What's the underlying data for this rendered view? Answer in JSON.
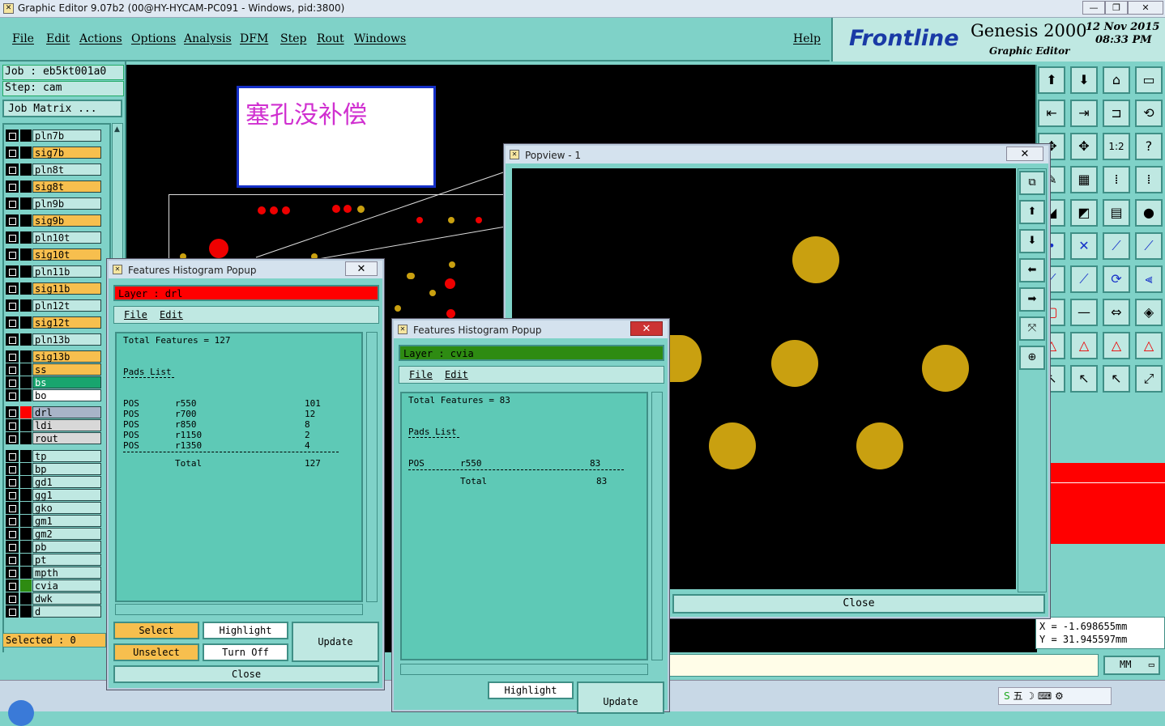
{
  "window": {
    "title": "Graphic Editor 9.07b2 (00@HY-HYCAM-PC091 - Windows, pid:3800)"
  },
  "menu": {
    "items": [
      "File",
      "Edit",
      "Actions",
      "Options",
      "Analysis",
      "DFM",
      "Step",
      "Rout",
      "Windows"
    ],
    "help": "Help"
  },
  "brand": {
    "logo": "Frontline",
    "product": "Genesis 2000",
    "subtitle": "Graphic Editor",
    "date": "12 Nov 2015",
    "time": "08:33 PM"
  },
  "job": {
    "job_line": "Job : eb5kt001a0",
    "step_line": "Step: cam",
    "matrix_button": "Job Matrix ..."
  },
  "layers": [
    {
      "name": "pln7b",
      "color": "#bfe8e2"
    },
    {
      "name": "sig7b",
      "color": "#f7bf4e"
    },
    {
      "name": "pln8t",
      "color": "#bfe8e2"
    },
    {
      "name": "sig8t",
      "color": "#f7bf4e"
    },
    {
      "name": "pln9b",
      "color": "#bfe8e2"
    },
    {
      "name": "sig9b",
      "color": "#f7bf4e"
    },
    {
      "name": "pln10t",
      "color": "#bfe8e2"
    },
    {
      "name": "sig10t",
      "color": "#f7bf4e"
    },
    {
      "name": "pln11b",
      "color": "#bfe8e2"
    },
    {
      "name": "sig11b",
      "color": "#f7bf4e"
    },
    {
      "name": "pln12t",
      "color": "#bfe8e2"
    },
    {
      "name": "sig12t",
      "color": "#f7bf4e"
    },
    {
      "name": "pln13b",
      "color": "#bfe8e2"
    },
    {
      "name": "sig13b",
      "color": "#f7bf4e"
    },
    {
      "name": "ss",
      "color": "#f7bf4e"
    },
    {
      "name": "bs",
      "color": "#18a56e"
    },
    {
      "name": "bo",
      "color": "#ffffff"
    },
    {
      "name": "drl",
      "color": "#a8b4c8"
    },
    {
      "name": "ldi",
      "color": "#d8d8d8"
    },
    {
      "name": "rout",
      "color": "#d8d8d8"
    },
    {
      "name": "tp",
      "color": "#bfe8e2"
    },
    {
      "name": "bp",
      "color": "#bfe8e2"
    },
    {
      "name": "gd1",
      "color": "#bfe8e2"
    },
    {
      "name": "gg1",
      "color": "#bfe8e2"
    },
    {
      "name": "gko",
      "color": "#bfe8e2"
    },
    {
      "name": "gm1",
      "color": "#bfe8e2"
    },
    {
      "name": "gm2",
      "color": "#bfe8e2"
    },
    {
      "name": "pb",
      "color": "#bfe8e2"
    },
    {
      "name": "pt",
      "color": "#bfe8e2"
    },
    {
      "name": "mpth",
      "color": "#bfe8e2"
    },
    {
      "name": "cvia",
      "color": "#bfe8e2"
    },
    {
      "name": "dwk",
      "color": "#bfe8e2"
    },
    {
      "name": "d",
      "color": "#bfe8e2"
    }
  ],
  "selected": "Selected : 0",
  "note": "塞孔没补偿",
  "histogram1": {
    "title": "Features Histogram Popup",
    "layer": "Layer :  drl",
    "menu": [
      "File",
      "Edit"
    ],
    "total_features": "Total Features = 127",
    "pads_list": "Pads List",
    "rows": [
      [
        "POS",
        "r550",
        "101"
      ],
      [
        "POS",
        "r700",
        "12"
      ],
      [
        "POS",
        "r850",
        "8"
      ],
      [
        "POS",
        "r1150",
        "2"
      ],
      [
        "POS",
        "r1350",
        "4"
      ]
    ],
    "total_label": "Total",
    "total": "127",
    "buttons": {
      "select": "Select",
      "highlight": "Highlight",
      "update": "Update",
      "unselect": "Unselect",
      "turn_off": "Turn Off",
      "close": "Close"
    }
  },
  "histogram2": {
    "title": "Features Histogram Popup",
    "layer": "Layer :  cvia",
    "menu": [
      "File",
      "Edit"
    ],
    "total_features": "Total Features = 83",
    "pads_list": "Pads List",
    "rows": [
      [
        "POS",
        "r550",
        "83"
      ]
    ],
    "total_label": "Total",
    "total": "83",
    "buttons": {
      "highlight": "Highlight",
      "update": "Update"
    }
  },
  "popview": {
    "title": "Popview - 1",
    "close": "Close"
  },
  "coords": {
    "x": "X  = -1.698655mm",
    "y": "Y  = 31.945597mm"
  },
  "units": "MM",
  "xy_label": "X Y",
  "colors": {
    "panel": "#7fd2c8",
    "light": "#bfe8e2",
    "signal": "#f7bf4e",
    "drill": "#ff0000",
    "cvia": "#2e8b12",
    "pad": "#c9a010"
  }
}
